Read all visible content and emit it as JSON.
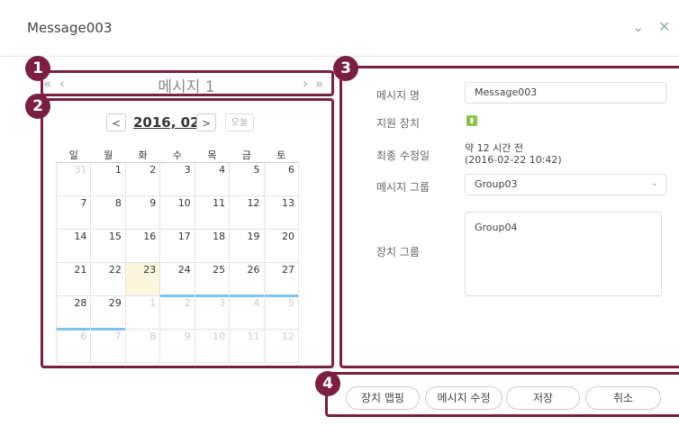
{
  "window": {
    "title": "Message003"
  },
  "badges": [
    "1",
    "2",
    "3",
    "4"
  ],
  "nav": {
    "title": "메시지 1",
    "first": "«",
    "prev": "‹",
    "next": "›",
    "last": "»"
  },
  "calendar": {
    "month_label": "2016, 02",
    "prev": "<",
    "next": ">",
    "today": "오늘",
    "weekdays": [
      "일",
      "월",
      "화",
      "수",
      "목",
      "금",
      "토"
    ],
    "weeks": [
      [
        {
          "d": "31",
          "o": true
        },
        {
          "d": "1"
        },
        {
          "d": "2"
        },
        {
          "d": "3"
        },
        {
          "d": "4"
        },
        {
          "d": "5"
        },
        {
          "d": "6"
        }
      ],
      [
        {
          "d": "7"
        },
        {
          "d": "8"
        },
        {
          "d": "9"
        },
        {
          "d": "10"
        },
        {
          "d": "11"
        },
        {
          "d": "12"
        },
        {
          "d": "13"
        }
      ],
      [
        {
          "d": "14"
        },
        {
          "d": "15"
        },
        {
          "d": "16"
        },
        {
          "d": "17"
        },
        {
          "d": "18"
        },
        {
          "d": "19"
        },
        {
          "d": "20"
        }
      ],
      [
        {
          "d": "21"
        },
        {
          "d": "22"
        },
        {
          "d": "23",
          "today": true
        },
        {
          "d": "24",
          "ev": true
        },
        {
          "d": "25",
          "ev": true
        },
        {
          "d": "26",
          "ev": true
        },
        {
          "d": "27",
          "ev": true
        }
      ],
      [
        {
          "d": "28",
          "ev": true
        },
        {
          "d": "29",
          "ev": true
        },
        {
          "d": "1",
          "o": true
        },
        {
          "d": "2",
          "o": true
        },
        {
          "d": "3",
          "o": true
        },
        {
          "d": "4",
          "o": true
        },
        {
          "d": "5",
          "o": true
        }
      ],
      [
        {
          "d": "6",
          "o": true
        },
        {
          "d": "7",
          "o": true
        },
        {
          "d": "8",
          "o": true
        },
        {
          "d": "9",
          "o": true
        },
        {
          "d": "10",
          "o": true
        },
        {
          "d": "11",
          "o": true
        },
        {
          "d": "12",
          "o": true
        }
      ]
    ],
    "event_color": "#7cc3f0",
    "today_color": "#fbf6dd"
  },
  "details": {
    "name_label": "메시지 명",
    "name_value": "Message003",
    "device_label": "지원 장치",
    "modified_label": "최종 수정일",
    "modified_relative": "약 12 시간 전",
    "modified_date": "(2016-02-22 10:42)",
    "group_label": "메시지 그룹",
    "group_value": "Group03",
    "device_group_label": "장치 그룹",
    "device_group_value": "Group04"
  },
  "buttons": {
    "device_mapping": "장치 맵핑",
    "edit_message": "메시지 수정",
    "save": "저장",
    "cancel": "취소"
  },
  "colors": {
    "highlight": "#7a1e42",
    "device_icon": "#8bc34a"
  }
}
